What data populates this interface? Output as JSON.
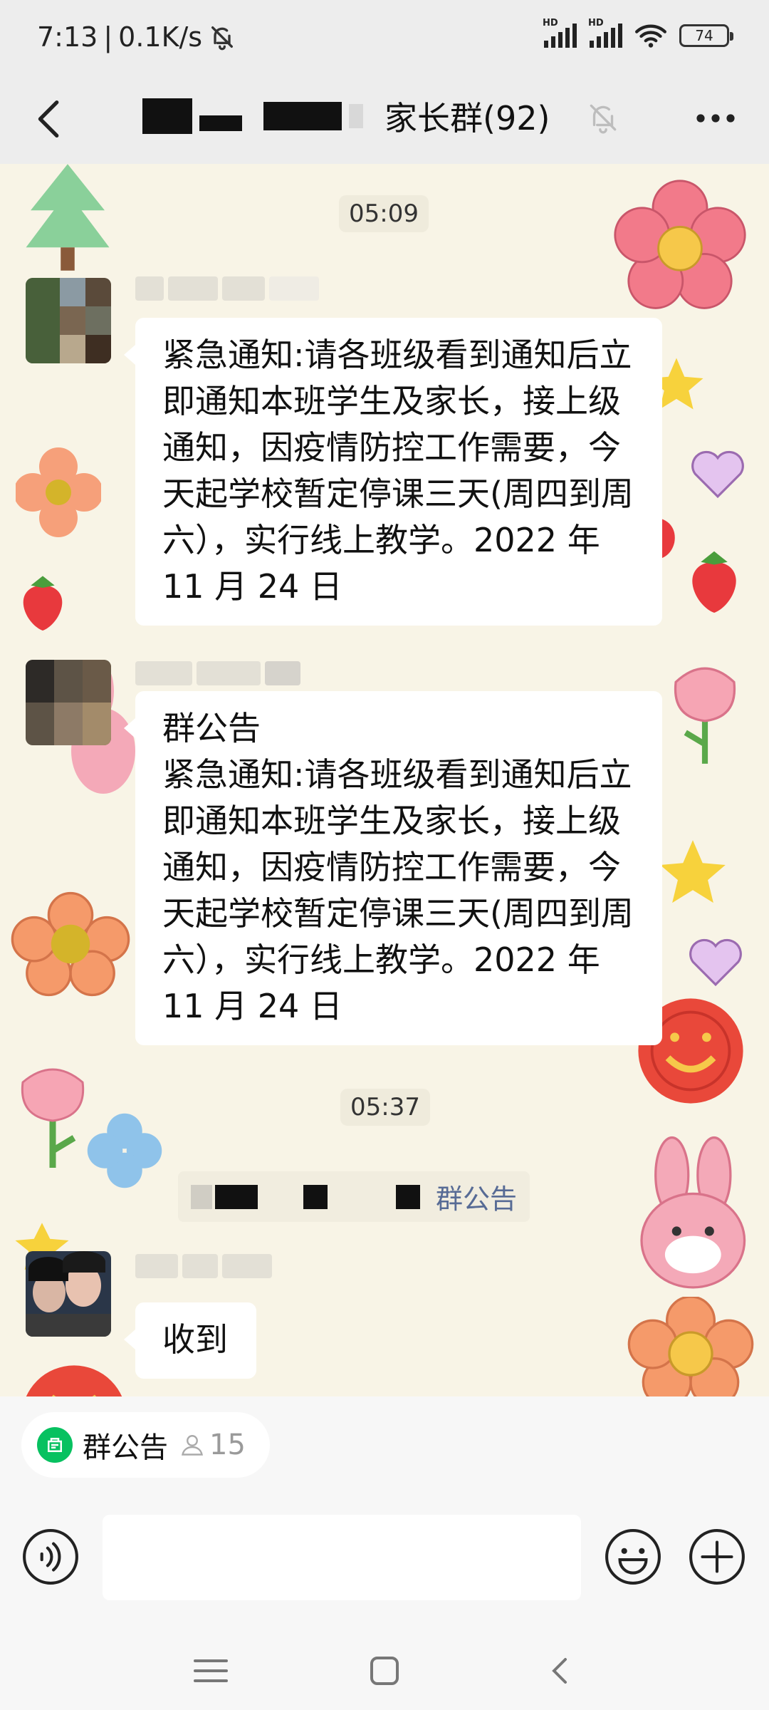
{
  "status": {
    "time": "7:13",
    "speed": "0.1K/s",
    "signal1": "HD",
    "signal2": "HD",
    "battery": "74"
  },
  "header": {
    "title": "家长群(92)"
  },
  "messages": [
    {
      "kind": "time",
      "text": "05:09"
    },
    {
      "kind": "text",
      "text": "紧急通知:请各班级看到通知后立即通知本班学生及家长，接上级通知，因疫情防控工作需要，今天起学校暂定停课三天(周四到周六），实行线上教学。2022 年 11 月 24 日"
    },
    {
      "kind": "notice",
      "title": "群公告",
      "text": "紧急通知:请各班级看到通知后立即通知本班学生及家长，接上级通知，因疫情防控工作需要，今天起学校暂定停课三天(周四到周六），实行线上教学。2022 年 11 月 24 日"
    },
    {
      "kind": "time",
      "text": "05:37"
    },
    {
      "kind": "system",
      "link": "群公告"
    },
    {
      "kind": "text",
      "text": "收到"
    }
  ],
  "notice_chip": {
    "label": "群公告",
    "count": "15"
  },
  "colors": {
    "accent": "#07c160",
    "link": "#576b95",
    "chat_bg": "#f8f4e6"
  }
}
